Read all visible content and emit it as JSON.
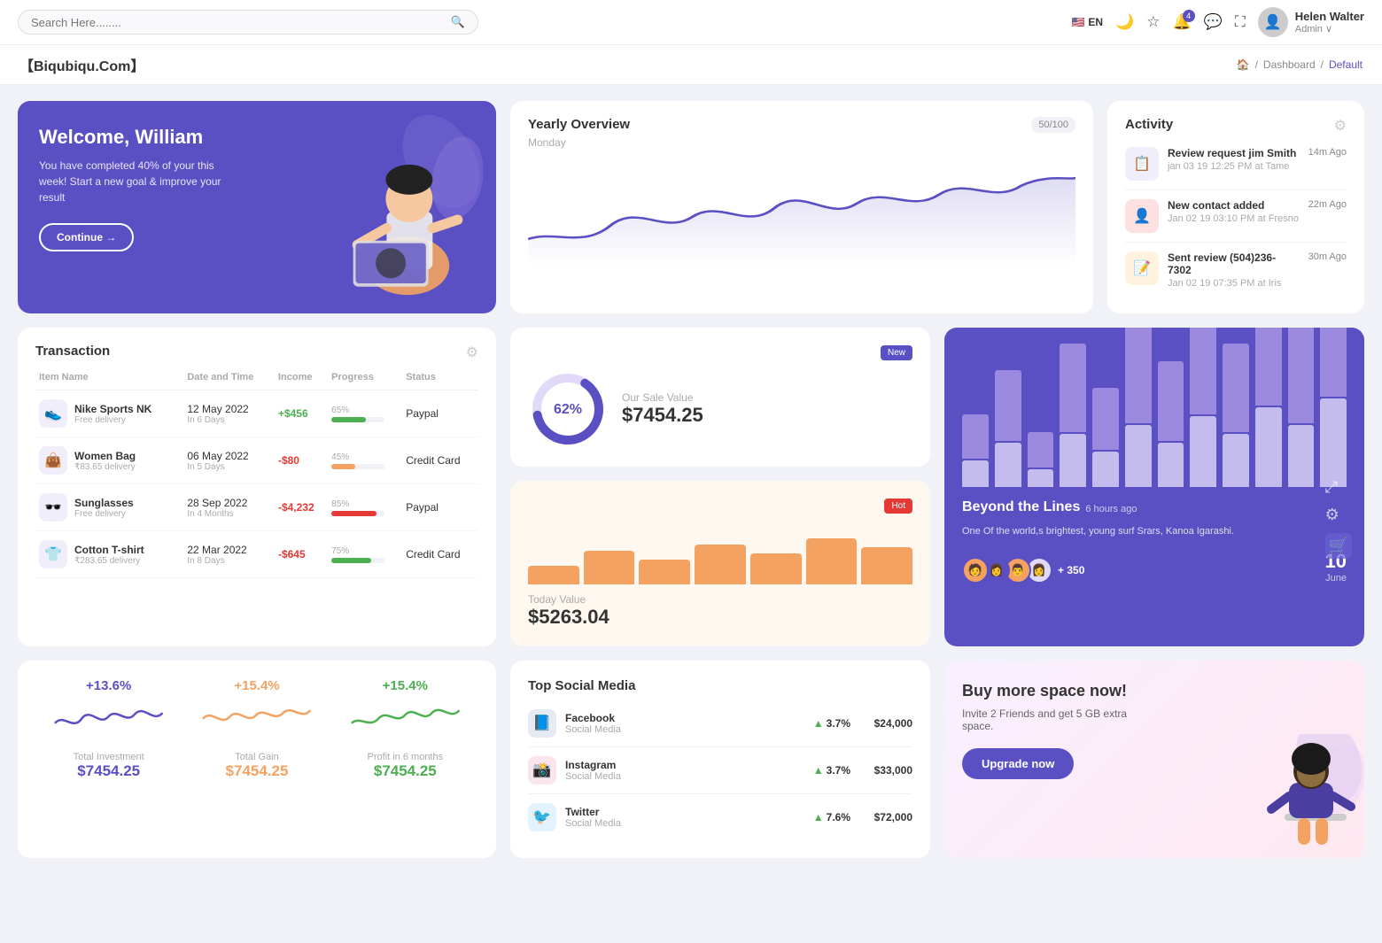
{
  "topnav": {
    "search_placeholder": "Search Here........",
    "lang": "EN",
    "notif_count": "4",
    "user_name": "Helen Walter",
    "user_role": "Admin"
  },
  "breadcrumb": {
    "brand": "【Biqubiqu.Com】",
    "home": "⌂",
    "path1": "Dashboard",
    "path2": "Default"
  },
  "welcome": {
    "title": "Welcome, William",
    "subtitle": "You have completed 40% of your this week! Start a new goal & improve your result",
    "btn_label": "Continue →"
  },
  "yearly": {
    "title": "Yearly Overview",
    "counter": "50/100",
    "subtitle": "Monday"
  },
  "activity": {
    "title": "Activity",
    "items": [
      {
        "title": "Review request jim Smith",
        "subtitle": "jan 03 19 12:25 PM at Tame",
        "time": "14m Ago"
      },
      {
        "title": "New contact added",
        "subtitle": "Jan 02 19 03:10 PM at Fresno",
        "time": "22m Ago"
      },
      {
        "title": "Sent review (504)236-7302",
        "subtitle": "Jan 02 19 07:35 PM at Iris",
        "time": "30m Ago"
      }
    ]
  },
  "transaction": {
    "title": "Transaction",
    "headers": [
      "Item Name",
      "Date and Time",
      "Income",
      "Progress",
      "Status"
    ],
    "rows": [
      {
        "icon": "👟",
        "name": "Nike Sports NK",
        "sub": "Free delivery",
        "date": "12 May 2022",
        "days": "In 6 Days",
        "income": "+$456",
        "income_type": "pos",
        "progress": 65,
        "progress_color": "#4caf50",
        "status": "Paypal"
      },
      {
        "icon": "👜",
        "name": "Women Bag",
        "sub": "₹83.65 delivery",
        "date": "06 May 2022",
        "days": "In 5 Days",
        "income": "-$80",
        "income_type": "neg",
        "progress": 45,
        "progress_color": "#f4a261",
        "status": "Credit Card"
      },
      {
        "icon": "🕶️",
        "name": "Sunglasses",
        "sub": "Free delivery",
        "date": "28 Sep 2022",
        "days": "In 4 Months",
        "income": "-$4,232",
        "income_type": "neg",
        "progress": 85,
        "progress_color": "#e53935",
        "status": "Paypal"
      },
      {
        "icon": "👕",
        "name": "Cotton T-shirt",
        "sub": "₹283.65 delivery",
        "date": "22 Mar 2022",
        "days": "In 8 Days",
        "income": "-$645",
        "income_type": "neg",
        "progress": 75,
        "progress_color": "#4caf50",
        "status": "Credit Card"
      }
    ]
  },
  "sale_value": {
    "badge": "New",
    "label": "Our Sale Value",
    "value": "$7454.25",
    "percent": 62
  },
  "today_value": {
    "badge": "Hot",
    "label": "Today Value",
    "value": "$5263.04",
    "bars": [
      30,
      55,
      40,
      65,
      50,
      75,
      60
    ]
  },
  "beyond": {
    "title": "Beyond the Lines",
    "time": "6 hours ago",
    "desc": "One Of the world,s brightest, young surf Srars, Kanoa Igarashi.",
    "plus_count": "+ 350",
    "date_num": "10",
    "date_month": "June",
    "bars": [
      {
        "light": 30,
        "dark": 50
      },
      {
        "light": 50,
        "dark": 80
      },
      {
        "light": 20,
        "dark": 40
      },
      {
        "light": 60,
        "dark": 100
      },
      {
        "light": 40,
        "dark": 70
      },
      {
        "light": 70,
        "dark": 110
      },
      {
        "light": 50,
        "dark": 90
      },
      {
        "light": 80,
        "dark": 130
      },
      {
        "light": 60,
        "dark": 100
      },
      {
        "light": 90,
        "dark": 140
      },
      {
        "light": 70,
        "dark": 120
      },
      {
        "light": 100,
        "dark": 150
      }
    ]
  },
  "mini_stats": [
    {
      "pct": "+13.6%",
      "color": "#5b4fc4",
      "label": "Total Investment",
      "value": "$7454.25"
    },
    {
      "pct": "+15.4%",
      "color": "#f4a261",
      "label": "Total Gain",
      "value": "$7454.25"
    },
    {
      "pct": "+15.4%",
      "color": "#4caf50",
      "label": "Profit in 6 months",
      "value": "$7454.25"
    }
  ],
  "social": {
    "title": "Top Social Media",
    "items": [
      {
        "icon": "📘",
        "name": "Facebook",
        "type": "Social Media",
        "pct": "3.7%",
        "value": "$24,000",
        "icon_color": "#3b5998"
      },
      {
        "icon": "📸",
        "name": "Instagram",
        "type": "Social Media",
        "pct": "3.7%",
        "value": "$33,000",
        "icon_color": "#e1306c"
      },
      {
        "icon": "🐦",
        "name": "Twitter",
        "type": "Social Media",
        "pct": "7.6%",
        "value": "$72,000",
        "icon_color": "#1da1f2"
      }
    ]
  },
  "buyspace": {
    "title": "Buy more space now!",
    "desc": "Invite 2 Friends and get 5 GB extra space.",
    "btn_label": "Upgrade now"
  }
}
